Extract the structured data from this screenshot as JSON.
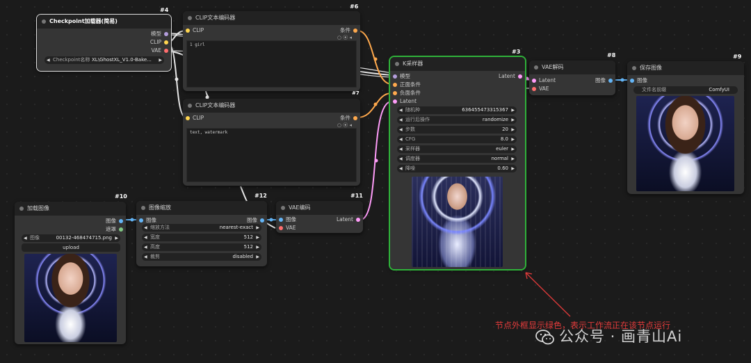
{
  "nodes": {
    "n4": {
      "id": "#4",
      "title": "Checkpoint加载器(简易)",
      "outputs": [
        "模型",
        "CLIP",
        "VAE"
      ],
      "widget": {
        "label": "Checkpoint名称",
        "value": "XL\\GhostXL_V1.0-Bake..."
      }
    },
    "n6": {
      "id": "#6",
      "title": "CLIP文本编码器",
      "input": "CLIP",
      "output": "条件",
      "text": "1 girl"
    },
    "n7": {
      "id": "#7",
      "title": "CLIP文本编码器",
      "input": "CLIP",
      "output": "条件",
      "text": "text, watermark"
    },
    "n3": {
      "id": "#3",
      "title": "K采样器",
      "inputs": [
        "模型",
        "正面条件",
        "负面条件",
        "Latent"
      ],
      "output": "Latent",
      "widgets": [
        {
          "label": "随机种",
          "value": "636455473315367"
        },
        {
          "label": "运行后操作",
          "value": "randomize"
        },
        {
          "label": "步数",
          "value": "20"
        },
        {
          "label": "CFG",
          "value": "8.0"
        },
        {
          "label": "采样器",
          "value": "euler"
        },
        {
          "label": "调度器",
          "value": "normal"
        },
        {
          "label": "降噪",
          "value": "0.60"
        }
      ]
    },
    "n8": {
      "id": "#8",
      "title": "VAE解码",
      "inputs": [
        "Latent",
        "VAE"
      ],
      "output": "图像"
    },
    "n9": {
      "id": "#9",
      "title": "保存图像",
      "input": "图像",
      "widget": {
        "label": "文件名前缀",
        "value": "ComfyUI"
      }
    },
    "n10": {
      "id": "#10",
      "title": "加载图像",
      "outputs": [
        "图像",
        "遮罩"
      ],
      "widget": {
        "label": "图像",
        "value": "00132-468474715.png"
      },
      "button": "upload"
    },
    "n12": {
      "id": "#12",
      "title": "图像缩放",
      "input": "图像",
      "output": "图像",
      "widgets": [
        {
          "label": "缩放方法",
          "value": "nearest-exact"
        },
        {
          "label": "宽度",
          "value": "512"
        },
        {
          "label": "高度",
          "value": "512"
        },
        {
          "label": "裁剪",
          "value": "disabled"
        }
      ]
    },
    "n11": {
      "id": "#11",
      "title": "VAE编码",
      "inputs": [
        "图像",
        "VAE"
      ],
      "output": "Latent"
    }
  },
  "annotation": "节点外框显示绿色，表示工作流正在该节点运行",
  "watermark": "公众号 · 画青山Ai",
  "colors": {
    "running_outline": "#2fb33a",
    "annotation": "#e23b3b",
    "model": "#b39ddb",
    "clip": "#ffd54f",
    "vae": "#ff6e6e",
    "conditioning": "#ffa94d",
    "latent": "#ff9cf9",
    "image": "#64b5f6",
    "mask": "#81c784"
  }
}
